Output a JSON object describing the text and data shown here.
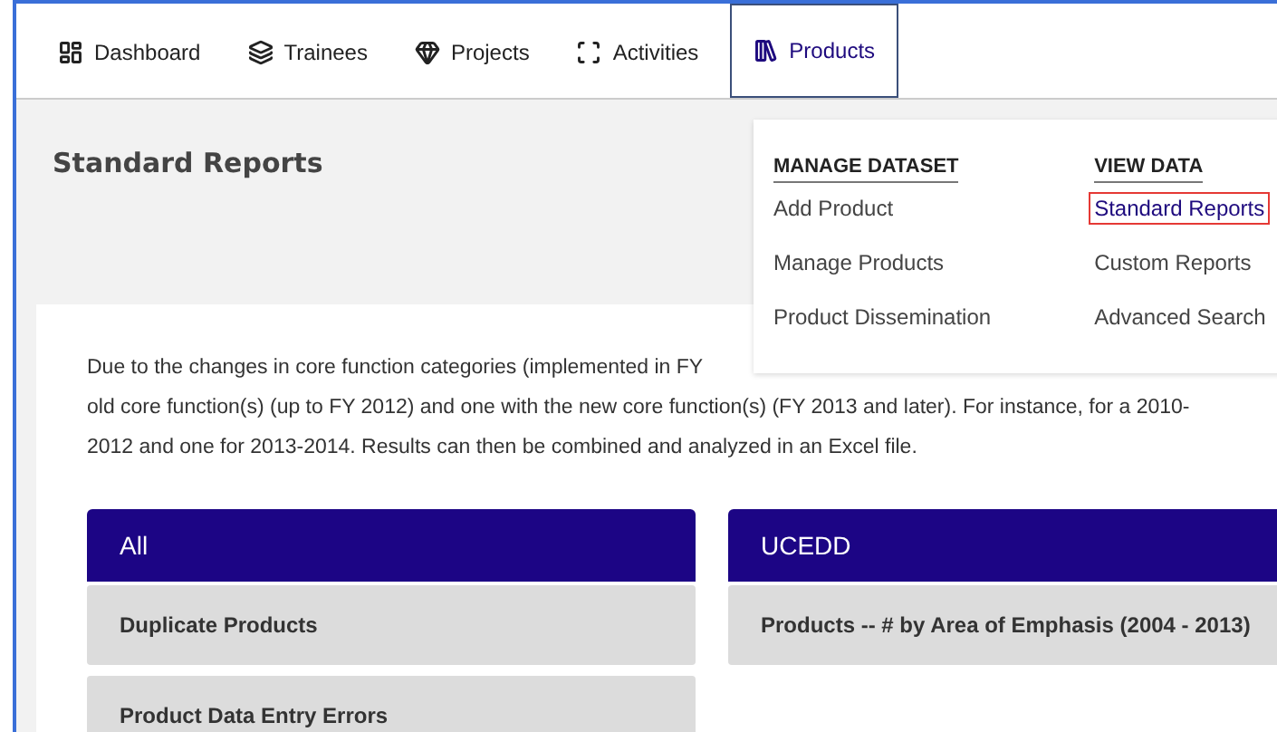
{
  "nav": [
    {
      "label": "Dashboard",
      "selected": false
    },
    {
      "label": "Trainees",
      "selected": false
    },
    {
      "label": "Projects",
      "selected": false
    },
    {
      "label": "Activities",
      "selected": false
    },
    {
      "label": "Products",
      "selected": true
    }
  ],
  "page_title": "Standard Reports",
  "menu": {
    "columns": [
      {
        "heading": "MANAGE DATASET",
        "items": [
          {
            "label": "Add Product",
            "selected": false
          },
          {
            "label": "Manage Products",
            "selected": false
          },
          {
            "label": "Product Dissemination",
            "selected": false
          }
        ]
      },
      {
        "heading": "VIEW DATA",
        "items": [
          {
            "label": "Standard Reports",
            "selected": true
          },
          {
            "label": "Custom Reports",
            "selected": false
          },
          {
            "label": "Advanced Search",
            "selected": false
          }
        ]
      }
    ]
  },
  "intro_lines": [
    "Due to the changes in core function categories (implemented in FY",
    "old core function(s) (up to FY 2012) and one with the new core function(s) (FY 2013 and later). For instance, for a 2010-",
    "2012 and one for 2013-2014. Results can then be combined and analyzed in an Excel file."
  ],
  "report_groups": [
    {
      "title": "All",
      "reports": [
        "Duplicate Products",
        "Product Data Entry Errors"
      ]
    },
    {
      "title": "UCEDD",
      "reports": [
        "Products -- # by Area of Emphasis (2004 - 2013)"
      ]
    }
  ]
}
